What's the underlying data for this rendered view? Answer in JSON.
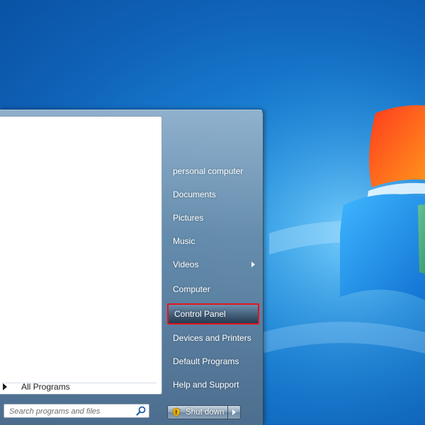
{
  "start_menu": {
    "all_programs_label": "All Programs",
    "search": {
      "placeholder": "Search programs and files"
    },
    "right_items": [
      {
        "label": "personal computer"
      },
      {
        "label": "Documents"
      },
      {
        "label": "Pictures"
      },
      {
        "label": "Music"
      },
      {
        "label": "Videos",
        "has_submenu": true
      },
      {
        "label": "Computer"
      },
      {
        "label": "Control Panel",
        "highlighted": true
      },
      {
        "label": "Devices and Printers"
      },
      {
        "label": "Default Programs"
      },
      {
        "label": "Help and Support"
      }
    ],
    "shutdown_label": "Shut down"
  },
  "colors": {
    "highlight_border": "#e3151f",
    "desktop_blue": "#1a7fd2"
  },
  "icons": {
    "search": "search-icon",
    "shutdown_shield": "shield-icon",
    "windows_flag": "windows-logo-icon"
  }
}
